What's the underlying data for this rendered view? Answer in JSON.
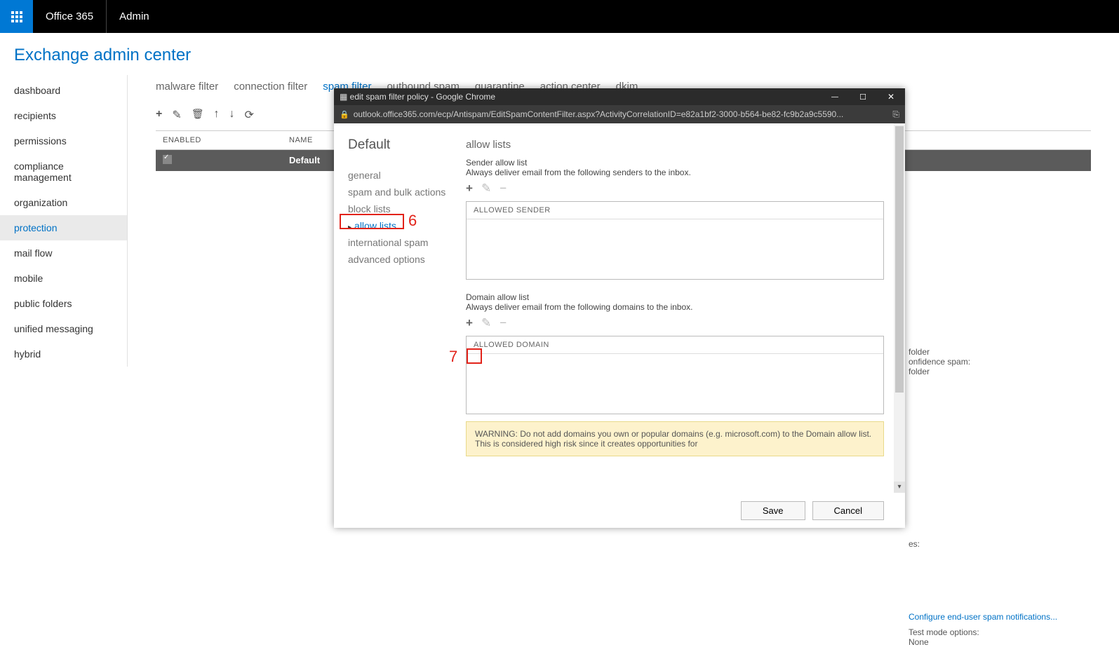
{
  "topbar": {
    "product": "Office 365",
    "area": "Admin"
  },
  "page_title": "Exchange admin center",
  "sidebar": {
    "items": [
      {
        "label": "dashboard"
      },
      {
        "label": "recipients"
      },
      {
        "label": "permissions"
      },
      {
        "label": "compliance management"
      },
      {
        "label": "organization"
      },
      {
        "label": "protection",
        "active": true
      },
      {
        "label": "mail flow"
      },
      {
        "label": "mobile"
      },
      {
        "label": "public folders"
      },
      {
        "label": "unified messaging"
      },
      {
        "label": "hybrid"
      }
    ]
  },
  "tabs": [
    {
      "label": "malware filter"
    },
    {
      "label": "connection filter"
    },
    {
      "label": "spam filter",
      "active": true
    },
    {
      "label": "outbound spam"
    },
    {
      "label": "quarantine"
    },
    {
      "label": "action center"
    },
    {
      "label": "dkim"
    }
  ],
  "grid": {
    "headers": {
      "enabled": "ENABLED",
      "name": "NAME"
    },
    "rows": [
      {
        "enabled": true,
        "name": "Default",
        "selected": true
      }
    ]
  },
  "right_panel": {
    "line1_suffix": "folder",
    "line2_prefix": "onfidence spam:",
    "line3_suffix": "folder",
    "line4": "es:",
    "link": "Configure end-user spam notifications...",
    "opt_label": "Test mode options:",
    "opt_value": "None"
  },
  "popup": {
    "window_title": "edit spam filter policy - Google Chrome",
    "address": "outlook.office365.com/ecp/Antispam/EditSpamContentFilter.aspx?ActivityCorrelationID=e82a1bf2-3000-b564-be82-fc9b2a9c5590...",
    "title": "Default",
    "nav": [
      {
        "label": "general"
      },
      {
        "label": "spam and bulk actions"
      },
      {
        "label": "block lists"
      },
      {
        "label": "allow lists",
        "active": true
      },
      {
        "label": "international spam"
      },
      {
        "label": "advanced options"
      }
    ],
    "section_title": "allow lists",
    "sender": {
      "label": "Sender allow list",
      "desc": "Always deliver email from the following senders to the inbox.",
      "header": "ALLOWED SENDER"
    },
    "domain": {
      "label": "Domain allow list",
      "desc": "Always deliver email from the following domains to the inbox.",
      "header": "ALLOWED DOMAIN"
    },
    "warning": "WARNING: Do not add domains you own or popular domains (e.g. microsoft.com) to the Domain allow list. This is considered high risk since it creates opportunities for",
    "buttons": {
      "save": "Save",
      "cancel": "Cancel"
    }
  },
  "annotations": {
    "n6": "6",
    "n7": "7"
  }
}
